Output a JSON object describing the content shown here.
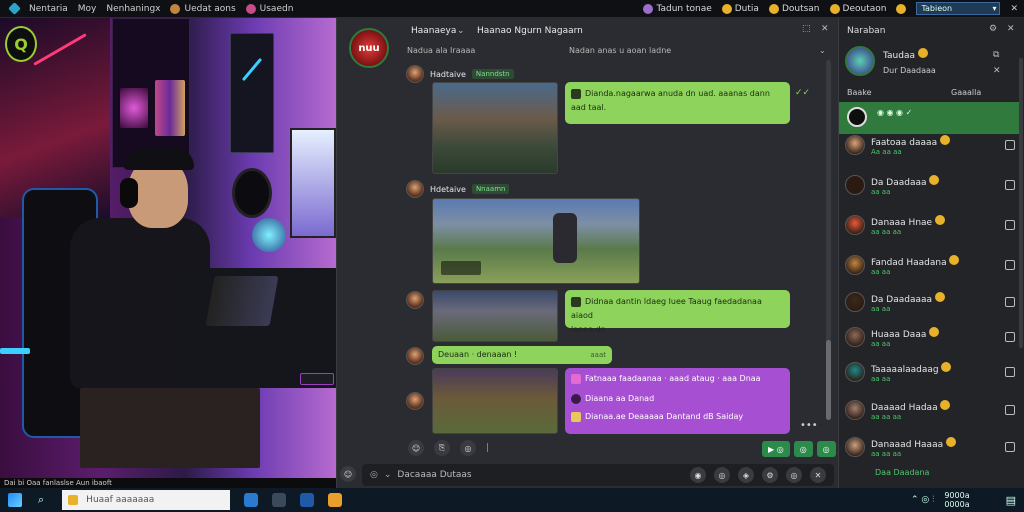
{
  "topbar": {
    "items": [
      "Nentaria",
      "Moy",
      "Nenhaningx",
      "Uedat aons",
      "Usaedn"
    ],
    "right_badges": [
      "Tadun tonae",
      "Dutia",
      "Doutsan",
      "Deoutaon"
    ],
    "search_value": "Tabieon",
    "colors": {
      "app": "#2fa3c7"
    }
  },
  "stream": {
    "logo_text": "Q",
    "caption": "Dai bi Oaa fanlaslse Aun ibaoft"
  },
  "chat": {
    "channel_logo_text": "nuu",
    "title": "Haanaeya",
    "title_suffix": "Haanao Ngurn Nagaarn",
    "subheader_left": "Nadua ala Iraaaa",
    "subheader_mid": "Nadan anas u aoan ladne",
    "messages": [
      {
        "user": "Hadtaive",
        "tag": "Nanndstn"
      },
      {
        "user": "Hdetaive",
        "tag": "Nnaamn"
      },
      {
        "user": "",
        "tag": ""
      },
      {
        "user": "",
        "tag": ""
      },
      {
        "user": "",
        "tag": ""
      }
    ],
    "bubbles": {
      "b1_line1": "Dianda.nagaarwa anuda dn uad. aaanas dann",
      "b1_line2": "aad taal.",
      "b2_line1": "Didnaa dantin ldaeg luee Taaug faedadanaa aiaod",
      "b2_line2": "lanaa.dn",
      "b3": "Deuaan · denaaan !",
      "b3_tag": "aaat",
      "p_line1": "Fatnaaa faadaanaa · aaad ataug · aaa Dnaa",
      "p_line2": "Diaana aa Danad",
      "p_line3": "Dianaa.ae Deaaaaa Dantand dB Saiday"
    },
    "composer_placeholder": "Dacaaaa Dutaas",
    "buttons": [
      "▶ ◎",
      "◎",
      "◎"
    ]
  },
  "members": {
    "header": "Naraban",
    "self_name": "Taudaa",
    "self_status": "Dur Daadaaa",
    "col_left": "Baake",
    "col_right": "Gaaalla",
    "list": [
      {
        "name": "Faatoaa daaaa",
        "sub": "Aa aa aa"
      },
      {
        "name": "Da Daadaaa",
        "sub": "aa aa"
      },
      {
        "name": "Danaaa Hnae",
        "sub": "aa aa aa"
      },
      {
        "name": "Fandad Haadana",
        "sub": "aa aa"
      },
      {
        "name": "Da Daadaaaa",
        "sub": "aa aa"
      },
      {
        "name": "Huaaa Daaa",
        "sub": "aa aa"
      },
      {
        "name": "Taaaaalaadaag",
        "sub": "aa aa"
      },
      {
        "name": "Daaaad Hadaa",
        "sub": "aa aa aa"
      },
      {
        "name": "Danaaad Haaaa",
        "sub": "aa aa aa"
      }
    ],
    "footer": "Daa Daadana"
  },
  "taskbar": {
    "search_placeholder": "Huaaf aaaaaaa",
    "clock_line1": "9000a",
    "clock_line2": "0000a"
  }
}
